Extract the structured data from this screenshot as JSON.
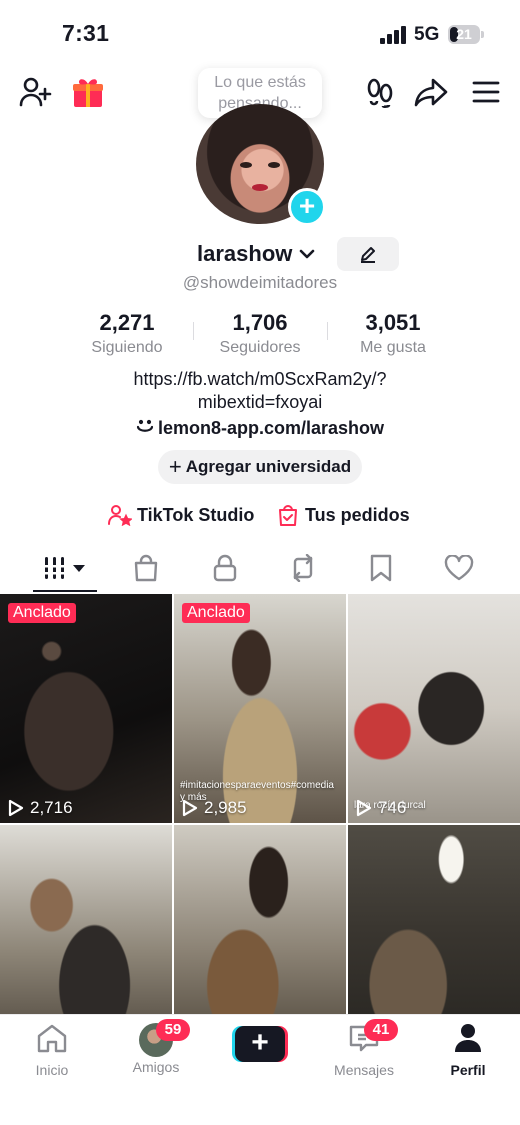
{
  "status_bar": {
    "time": "7:31",
    "network": "5G",
    "battery": "21"
  },
  "header": {
    "tooltip": "Lo que estás pensando...",
    "icons": [
      "add-friend-icon",
      "gift-icon",
      "footprints-icon",
      "share-icon",
      "menu-icon"
    ]
  },
  "profile": {
    "username": "larashow",
    "handle": "@showdeimitadores",
    "stats": [
      {
        "value": "2,271",
        "label": "Siguiendo"
      },
      {
        "value": "1,706",
        "label": "Seguidores"
      },
      {
        "value": "3,051",
        "label": "Me gusta"
      }
    ],
    "bio_line1": "https://fb.watch/m0ScxRam2y/?",
    "bio_line2": "mibextid=fxoyai",
    "link": "lemon8-app.com/larashow",
    "add_school": "Agregar universidad",
    "studio_label": "TikTok Studio",
    "orders_label": "Tus pedidos"
  },
  "tabs": [
    "videos-grid-icon",
    "shop-bag-icon",
    "private-lock-icon",
    "repost-icon",
    "bookmark-icon",
    "liked-heart-icon"
  ],
  "videos": [
    {
      "pinned": "Anclado",
      "views": "2,716",
      "caption": ""
    },
    {
      "pinned": "Anclado",
      "views": "2,985",
      "caption": "#imitacionesparaeventos#comedia y más"
    },
    {
      "pinned": "",
      "views": "746",
      "caption": "lara rocío durcal"
    },
    {
      "pinned": "",
      "views": "",
      "caption": ""
    },
    {
      "pinned": "",
      "views": "",
      "caption": ""
    },
    {
      "pinned": "",
      "views": "",
      "caption": ""
    }
  ],
  "bottom_nav": {
    "home": "Inicio",
    "friends": "Amigos",
    "friends_badge": "59",
    "messages": "Mensajes",
    "messages_badge": "41",
    "profile": "Perfil"
  },
  "colors": {
    "accent": "#fe2c55",
    "cyan": "#20d5ec",
    "text": "#161823",
    "muted": "#8a8b91"
  }
}
